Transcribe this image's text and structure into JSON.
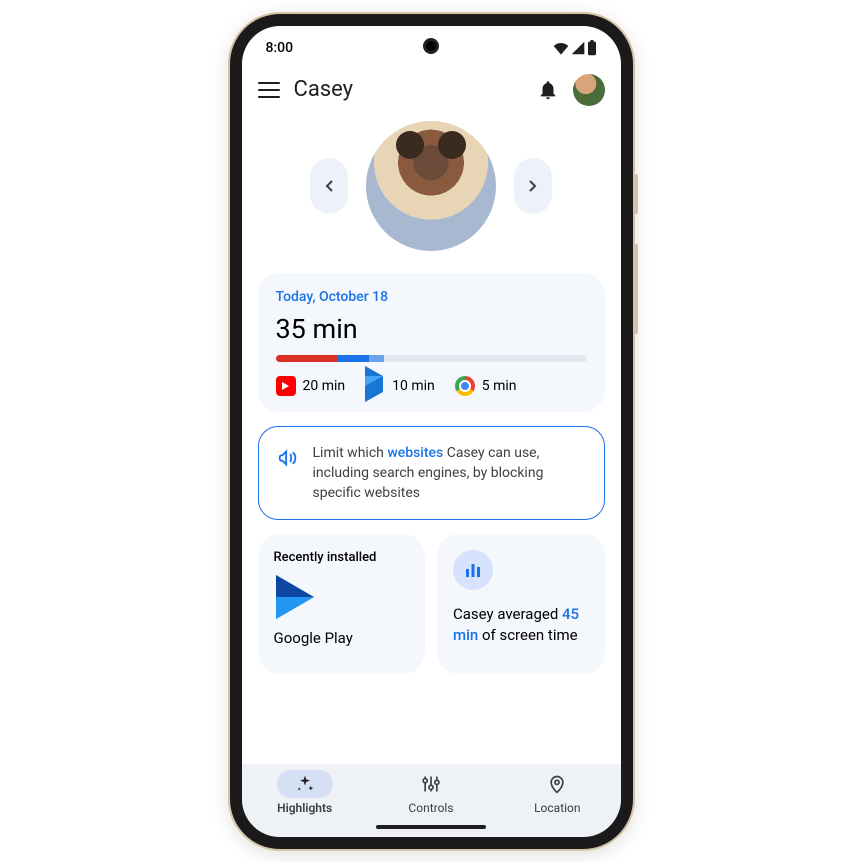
{
  "status": {
    "time": "8:00"
  },
  "header": {
    "title": "Casey"
  },
  "usage": {
    "date": "Today, October 18",
    "total": "35 min",
    "bar": {
      "percent_used": 35,
      "segments": [
        {
          "color": "#d93025",
          "width": 20
        },
        {
          "color": "#1a73e8",
          "width": 10
        },
        {
          "color": "#fbbc05",
          "width": 5
        }
      ]
    },
    "apps": [
      {
        "icon": "youtube-icon",
        "label": "20 min"
      },
      {
        "icon": "play-icon",
        "label": "10 min"
      },
      {
        "icon": "chrome-icon",
        "label": "5 min"
      }
    ]
  },
  "tip": {
    "pre": "Limit which ",
    "keyword": "websites",
    "post": " Casey can use, including search engines, by blocking specific websites"
  },
  "recent": {
    "title": "Recently installed",
    "app_name": "Google Play"
  },
  "stat": {
    "pre": "Casey averaged ",
    "value": "45 min",
    "post": " of screen time"
  },
  "nav": {
    "items": [
      {
        "label": "Highlights"
      },
      {
        "label": "Controls"
      },
      {
        "label": "Location"
      }
    ]
  }
}
